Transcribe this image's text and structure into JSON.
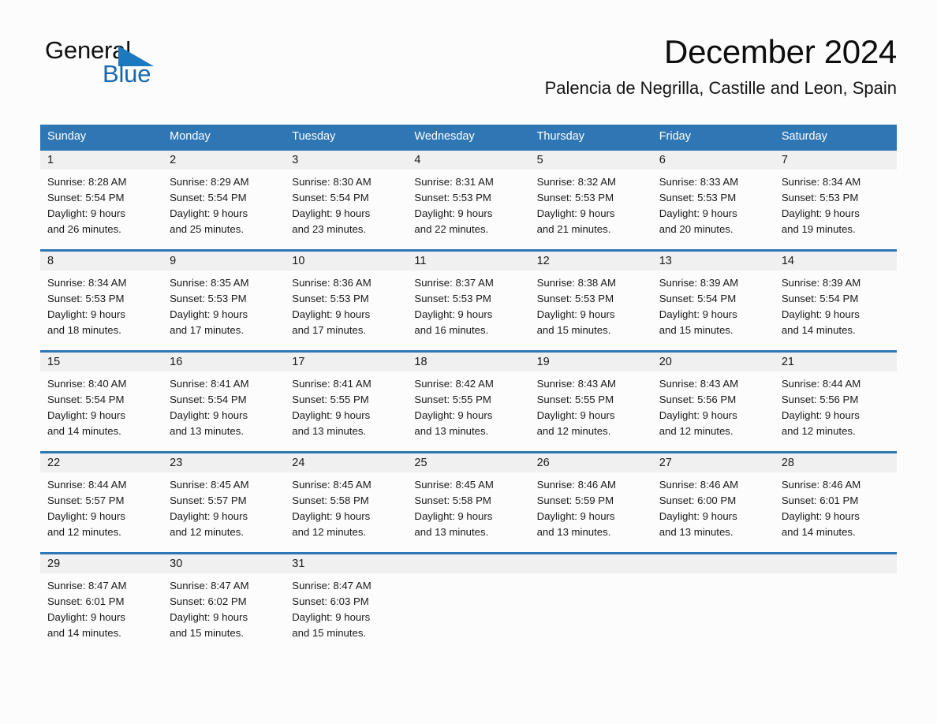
{
  "brand": {
    "name_part1": "General",
    "name_part2": "Blue",
    "triangle_color": "#1c78bf",
    "blue_text_color": "#1569b0"
  },
  "header": {
    "title": "December 2024",
    "subtitle": "Palencia de Negrilla, Castille and Leon, Spain"
  },
  "theme": {
    "header_blue": "#2f76b5",
    "date_band_gray": "#f0f0f0",
    "page_background": "#fcfcfc"
  },
  "weekdays": [
    "Sunday",
    "Monday",
    "Tuesday",
    "Wednesday",
    "Thursday",
    "Friday",
    "Saturday"
  ],
  "weeks": [
    {
      "dates": [
        "1",
        "2",
        "3",
        "4",
        "5",
        "6",
        "7"
      ],
      "cells": [
        {
          "sunrise": "Sunrise: 8:28 AM",
          "sunset": "Sunset: 5:54 PM",
          "daylight1": "Daylight: 9 hours",
          "daylight2": "and 26 minutes."
        },
        {
          "sunrise": "Sunrise: 8:29 AM",
          "sunset": "Sunset: 5:54 PM",
          "daylight1": "Daylight: 9 hours",
          "daylight2": "and 25 minutes."
        },
        {
          "sunrise": "Sunrise: 8:30 AM",
          "sunset": "Sunset: 5:54 PM",
          "daylight1": "Daylight: 9 hours",
          "daylight2": "and 23 minutes."
        },
        {
          "sunrise": "Sunrise: 8:31 AM",
          "sunset": "Sunset: 5:53 PM",
          "daylight1": "Daylight: 9 hours",
          "daylight2": "and 22 minutes."
        },
        {
          "sunrise": "Sunrise: 8:32 AM",
          "sunset": "Sunset: 5:53 PM",
          "daylight1": "Daylight: 9 hours",
          "daylight2": "and 21 minutes."
        },
        {
          "sunrise": "Sunrise: 8:33 AM",
          "sunset": "Sunset: 5:53 PM",
          "daylight1": "Daylight: 9 hours",
          "daylight2": "and 20 minutes."
        },
        {
          "sunrise": "Sunrise: 8:34 AM",
          "sunset": "Sunset: 5:53 PM",
          "daylight1": "Daylight: 9 hours",
          "daylight2": "and 19 minutes."
        }
      ]
    },
    {
      "dates": [
        "8",
        "9",
        "10",
        "11",
        "12",
        "13",
        "14"
      ],
      "cells": [
        {
          "sunrise": "Sunrise: 8:34 AM",
          "sunset": "Sunset: 5:53 PM",
          "daylight1": "Daylight: 9 hours",
          "daylight2": "and 18 minutes."
        },
        {
          "sunrise": "Sunrise: 8:35 AM",
          "sunset": "Sunset: 5:53 PM",
          "daylight1": "Daylight: 9 hours",
          "daylight2": "and 17 minutes."
        },
        {
          "sunrise": "Sunrise: 8:36 AM",
          "sunset": "Sunset: 5:53 PM",
          "daylight1": "Daylight: 9 hours",
          "daylight2": "and 17 minutes."
        },
        {
          "sunrise": "Sunrise: 8:37 AM",
          "sunset": "Sunset: 5:53 PM",
          "daylight1": "Daylight: 9 hours",
          "daylight2": "and 16 minutes."
        },
        {
          "sunrise": "Sunrise: 8:38 AM",
          "sunset": "Sunset: 5:53 PM",
          "daylight1": "Daylight: 9 hours",
          "daylight2": "and 15 minutes."
        },
        {
          "sunrise": "Sunrise: 8:39 AM",
          "sunset": "Sunset: 5:54 PM",
          "daylight1": "Daylight: 9 hours",
          "daylight2": "and 15 minutes."
        },
        {
          "sunrise": "Sunrise: 8:39 AM",
          "sunset": "Sunset: 5:54 PM",
          "daylight1": "Daylight: 9 hours",
          "daylight2": "and 14 minutes."
        }
      ]
    },
    {
      "dates": [
        "15",
        "16",
        "17",
        "18",
        "19",
        "20",
        "21"
      ],
      "cells": [
        {
          "sunrise": "Sunrise: 8:40 AM",
          "sunset": "Sunset: 5:54 PM",
          "daylight1": "Daylight: 9 hours",
          "daylight2": "and 14 minutes."
        },
        {
          "sunrise": "Sunrise: 8:41 AM",
          "sunset": "Sunset: 5:54 PM",
          "daylight1": "Daylight: 9 hours",
          "daylight2": "and 13 minutes."
        },
        {
          "sunrise": "Sunrise: 8:41 AM",
          "sunset": "Sunset: 5:55 PM",
          "daylight1": "Daylight: 9 hours",
          "daylight2": "and 13 minutes."
        },
        {
          "sunrise": "Sunrise: 8:42 AM",
          "sunset": "Sunset: 5:55 PM",
          "daylight1": "Daylight: 9 hours",
          "daylight2": "and 13 minutes."
        },
        {
          "sunrise": "Sunrise: 8:43 AM",
          "sunset": "Sunset: 5:55 PM",
          "daylight1": "Daylight: 9 hours",
          "daylight2": "and 12 minutes."
        },
        {
          "sunrise": "Sunrise: 8:43 AM",
          "sunset": "Sunset: 5:56 PM",
          "daylight1": "Daylight: 9 hours",
          "daylight2": "and 12 minutes."
        },
        {
          "sunrise": "Sunrise: 8:44 AM",
          "sunset": "Sunset: 5:56 PM",
          "daylight1": "Daylight: 9 hours",
          "daylight2": "and 12 minutes."
        }
      ]
    },
    {
      "dates": [
        "22",
        "23",
        "24",
        "25",
        "26",
        "27",
        "28"
      ],
      "cells": [
        {
          "sunrise": "Sunrise: 8:44 AM",
          "sunset": "Sunset: 5:57 PM",
          "daylight1": "Daylight: 9 hours",
          "daylight2": "and 12 minutes."
        },
        {
          "sunrise": "Sunrise: 8:45 AM",
          "sunset": "Sunset: 5:57 PM",
          "daylight1": "Daylight: 9 hours",
          "daylight2": "and 12 minutes."
        },
        {
          "sunrise": "Sunrise: 8:45 AM",
          "sunset": "Sunset: 5:58 PM",
          "daylight1": "Daylight: 9 hours",
          "daylight2": "and 12 minutes."
        },
        {
          "sunrise": "Sunrise: 8:45 AM",
          "sunset": "Sunset: 5:58 PM",
          "daylight1": "Daylight: 9 hours",
          "daylight2": "and 13 minutes."
        },
        {
          "sunrise": "Sunrise: 8:46 AM",
          "sunset": "Sunset: 5:59 PM",
          "daylight1": "Daylight: 9 hours",
          "daylight2": "and 13 minutes."
        },
        {
          "sunrise": "Sunrise: 8:46 AM",
          "sunset": "Sunset: 6:00 PM",
          "daylight1": "Daylight: 9 hours",
          "daylight2": "and 13 minutes."
        },
        {
          "sunrise": "Sunrise: 8:46 AM",
          "sunset": "Sunset: 6:01 PM",
          "daylight1": "Daylight: 9 hours",
          "daylight2": "and 14 minutes."
        }
      ]
    },
    {
      "dates": [
        "29",
        "30",
        "31",
        "",
        "",
        "",
        ""
      ],
      "cells": [
        {
          "sunrise": "Sunrise: 8:47 AM",
          "sunset": "Sunset: 6:01 PM",
          "daylight1": "Daylight: 9 hours",
          "daylight2": "and 14 minutes."
        },
        {
          "sunrise": "Sunrise: 8:47 AM",
          "sunset": "Sunset: 6:02 PM",
          "daylight1": "Daylight: 9 hours",
          "daylight2": "and 15 minutes."
        },
        {
          "sunrise": "Sunrise: 8:47 AM",
          "sunset": "Sunset: 6:03 PM",
          "daylight1": "Daylight: 9 hours",
          "daylight2": "and 15 minutes."
        },
        {
          "sunrise": "",
          "sunset": "",
          "daylight1": "",
          "daylight2": ""
        },
        {
          "sunrise": "",
          "sunset": "",
          "daylight1": "",
          "daylight2": ""
        },
        {
          "sunrise": "",
          "sunset": "",
          "daylight1": "",
          "daylight2": ""
        },
        {
          "sunrise": "",
          "sunset": "",
          "daylight1": "",
          "daylight2": ""
        }
      ]
    }
  ]
}
